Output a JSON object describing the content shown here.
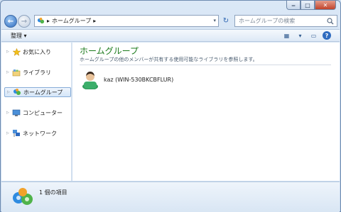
{
  "address": {
    "breadcrumb": "ホームグループ",
    "separator": "▸"
  },
  "search": {
    "placeholder": "ホームグループの検索"
  },
  "toolbar": {
    "organize_label": "整理 ▾"
  },
  "nav": {
    "items": [
      {
        "label": "お気に入り",
        "icon": "star-icon"
      },
      {
        "label": "ライブラリ",
        "icon": "library-icon"
      },
      {
        "label": "ホームグループ",
        "icon": "homegroup-icon",
        "selected": true
      },
      {
        "label": "コンピューター",
        "icon": "computer-icon"
      },
      {
        "label": "ネットワーク",
        "icon": "network-icon"
      }
    ]
  },
  "content": {
    "title": "ホームグループ",
    "description": "ホームグループの他のメンバーが共有する使用可能なライブラリを参照します。",
    "users": [
      {
        "label": "kaz (WIN-530BKCBFLUR)"
      }
    ]
  },
  "details": {
    "count_text": "1 個の項目"
  },
  "colors": {
    "accent": "#1b7a1b",
    "selection": "#d5e6f8"
  }
}
